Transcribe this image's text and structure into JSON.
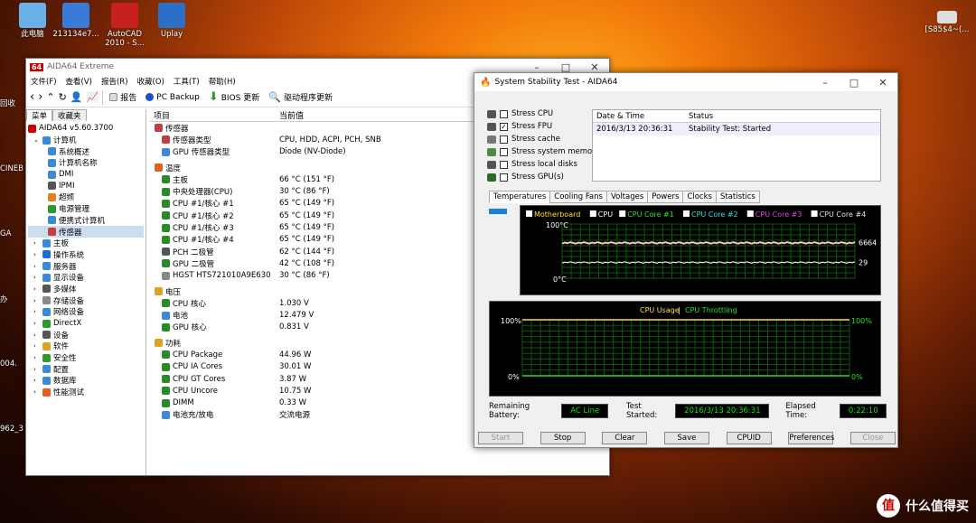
{
  "desktop": {
    "icons": [
      {
        "label": "此电脑",
        "color": "#6ab0e8"
      },
      {
        "label": "213134e7...",
        "color": "#3a7ad8"
      },
      {
        "label": "AutoCAD 2010 - S...",
        "color": "#c82020"
      },
      {
        "label": "Uplay",
        "color": "#2a70c8"
      }
    ],
    "right_icon_label": "[S85$4~(...",
    "left_stubs": [
      "回收",
      "CINEB",
      "GA",
      "办",
      "004.",
      "962_3"
    ]
  },
  "aida": {
    "title": "AIDA64 Extreme",
    "logo": "64",
    "menu": [
      "文件(F)",
      "查看(V)",
      "报告(R)",
      "收藏(O)",
      "工具(T)",
      "帮助(H)"
    ],
    "toolbar": {
      "report": "报告",
      "backup": "PC Backup",
      "bios": "BIOS 更新",
      "driver": "驱动程序更新"
    },
    "left_tabs": [
      "菜单",
      "收藏夹"
    ],
    "tree": [
      {
        "label": "AIDA64 v5.60.3700",
        "lvl": 0,
        "color": "#c00"
      },
      {
        "label": "计算机",
        "lvl": 1,
        "color": "#3a8ad8"
      },
      {
        "label": "系统概述",
        "lvl": 2,
        "color": "#3a8ad8"
      },
      {
        "label": "计算机名称",
        "lvl": 2,
        "color": "#3a8ad8"
      },
      {
        "label": "DMI",
        "lvl": 2,
        "color": "#3a8ad8"
      },
      {
        "label": "IPMI",
        "lvl": 2,
        "color": "#555"
      },
      {
        "label": "超频",
        "lvl": 2,
        "color": "#e08020"
      },
      {
        "label": "电源管理",
        "lvl": 2,
        "color": "#2a9a2a"
      },
      {
        "label": "便携式计算机",
        "lvl": 2,
        "color": "#3a8ad8"
      },
      {
        "label": "传感器",
        "lvl": 2,
        "color": "#c04040"
      },
      {
        "label": "主板",
        "lvl": 1,
        "color": "#3a8ad8"
      },
      {
        "label": "操作系统",
        "lvl": 1,
        "color": "#1a70d8"
      },
      {
        "label": "服务器",
        "lvl": 1,
        "color": "#3a8ad8"
      },
      {
        "label": "显示设备",
        "lvl": 1,
        "color": "#3a8ad8"
      },
      {
        "label": "多媒体",
        "lvl": 1,
        "color": "#555"
      },
      {
        "label": "存储设备",
        "lvl": 1,
        "color": "#888"
      },
      {
        "label": "网络设备",
        "lvl": 1,
        "color": "#3a8ad8"
      },
      {
        "label": "DirectX",
        "lvl": 1,
        "color": "#2a9a2a"
      },
      {
        "label": "设备",
        "lvl": 1,
        "color": "#555"
      },
      {
        "label": "软件",
        "lvl": 1,
        "color": "#e0a020"
      },
      {
        "label": "安全性",
        "lvl": 1,
        "color": "#2a9a2a"
      },
      {
        "label": "配置",
        "lvl": 1,
        "color": "#3a8ad8"
      },
      {
        "label": "数据库",
        "lvl": 1,
        "color": "#3a8ad8"
      },
      {
        "label": "性能测试",
        "lvl": 1,
        "color": "#e06020"
      }
    ],
    "col_item": "项目",
    "col_value": "当前值",
    "sections": [
      {
        "title": "传感器",
        "color": "#c04040",
        "rows": [
          {
            "k": "传感器类型",
            "v": "CPU, HDD, ACPI, PCH, SNB",
            "c": "#c04040"
          },
          {
            "k": "GPU 传感器类型",
            "v": "Diode (NV-Diode)",
            "c": "#3a8ad8"
          }
        ]
      },
      {
        "title": "温度",
        "color": "#e06020",
        "rows": [
          {
            "k": "主板",
            "v": "66 °C  (151 °F)",
            "c": "#2a8a2a"
          },
          {
            "k": "中央处理器(CPU)",
            "v": "30 °C  (86 °F)",
            "c": "#2a8a2a"
          },
          {
            "k": "CPU #1/核心 #1",
            "v": "65 °C  (149 °F)",
            "c": "#2a8a2a"
          },
          {
            "k": "CPU #1/核心 #2",
            "v": "65 °C  (149 °F)",
            "c": "#2a8a2a"
          },
          {
            "k": "CPU #1/核心 #3",
            "v": "65 °C  (149 °F)",
            "c": "#2a8a2a"
          },
          {
            "k": "CPU #1/核心 #4",
            "v": "65 °C  (149 °F)",
            "c": "#2a8a2a"
          },
          {
            "k": "PCH 二极管",
            "v": "62 °C  (144 °F)",
            "c": "#555"
          },
          {
            "k": "GPU 二极管",
            "v": "42 °C  (108 °F)",
            "c": "#2a8a2a"
          },
          {
            "k": "HGST HTS721010A9E630",
            "v": "30 °C  (86 °F)",
            "c": "#888"
          }
        ]
      },
      {
        "title": "电压",
        "color": "#e0a020",
        "rows": [
          {
            "k": "CPU 核心",
            "v": "1.030 V",
            "c": "#2a8a2a"
          },
          {
            "k": "电池",
            "v": "12.479 V",
            "c": "#3a8ad8"
          },
          {
            "k": "GPU 核心",
            "v": "0.831 V",
            "c": "#2a8a2a"
          }
        ]
      },
      {
        "title": "功耗",
        "color": "#e0a020",
        "rows": [
          {
            "k": "CPU Package",
            "v": "44.96 W",
            "c": "#2a8a2a"
          },
          {
            "k": "CPU IA Cores",
            "v": "30.01 W",
            "c": "#2a8a2a"
          },
          {
            "k": "CPU GT Cores",
            "v": "3.87 W",
            "c": "#2a8a2a"
          },
          {
            "k": "CPU Uncore",
            "v": "10.75 W",
            "c": "#2a8a2a"
          },
          {
            "k": "DIMM",
            "v": "0.33 W",
            "c": "#2a8a2a"
          },
          {
            "k": "电池充/放电",
            "v": "交流电源",
            "c": "#3a8ad8"
          }
        ]
      }
    ]
  },
  "stability": {
    "title": "System Stability Test - AIDA64",
    "stress": [
      {
        "label": "Stress CPU",
        "checked": false
      },
      {
        "label": "Stress FPU",
        "checked": true
      },
      {
        "label": "Stress cache",
        "checked": false
      },
      {
        "label": "Stress system memory",
        "checked": false
      },
      {
        "label": "Stress local disks",
        "checked": false
      },
      {
        "label": "Stress GPU(s)",
        "checked": false
      }
    ],
    "log_headers": [
      "Date & Time",
      "Status"
    ],
    "log_row": [
      "2016/3/13 20:36:31",
      "Stability Test: Started"
    ],
    "graph_tabs": [
      "Temperatures",
      "Cooling Fans",
      "Voltages",
      "Powers",
      "Clocks",
      "Statistics"
    ],
    "temp_legend": [
      {
        "label": "Motherboard",
        "color": "#ffe030"
      },
      {
        "label": "CPU",
        "color": "#ffffff"
      },
      {
        "label": "CPU Core #1",
        "color": "#30e030"
      },
      {
        "label": "CPU Core #2",
        "color": "#30e0e0"
      },
      {
        "label": "CPU Core #3",
        "color": "#e040e0"
      },
      {
        "label": "CPU Core #4",
        "color": "#e0e0e0"
      }
    ],
    "temp_axis": {
      "top": "100°C",
      "bottom": "0°C"
    },
    "temp_readouts": {
      "upper": "66",
      "upper2": "64",
      "lower": "29"
    },
    "usage_title": "CPU Usage",
    "usage_sep": "|",
    "throttle_title": "CPU Throttling",
    "usage_axis": {
      "left_top": "100%",
      "left_bottom": "0%",
      "right_top": "100%",
      "right_bottom": "0%"
    },
    "remaining_label": "Remaining Battery:",
    "remaining_value": "AC Line",
    "started_label": "Test Started:",
    "started_value": "2016/3/13 20:36:31",
    "elapsed_label": "Elapsed Time:",
    "elapsed_value": "0:22:10",
    "buttons": [
      "Start",
      "Stop",
      "Clear",
      "Save",
      "CPUID",
      "Preferences",
      "Close"
    ]
  },
  "watermark": "什么值得买"
}
